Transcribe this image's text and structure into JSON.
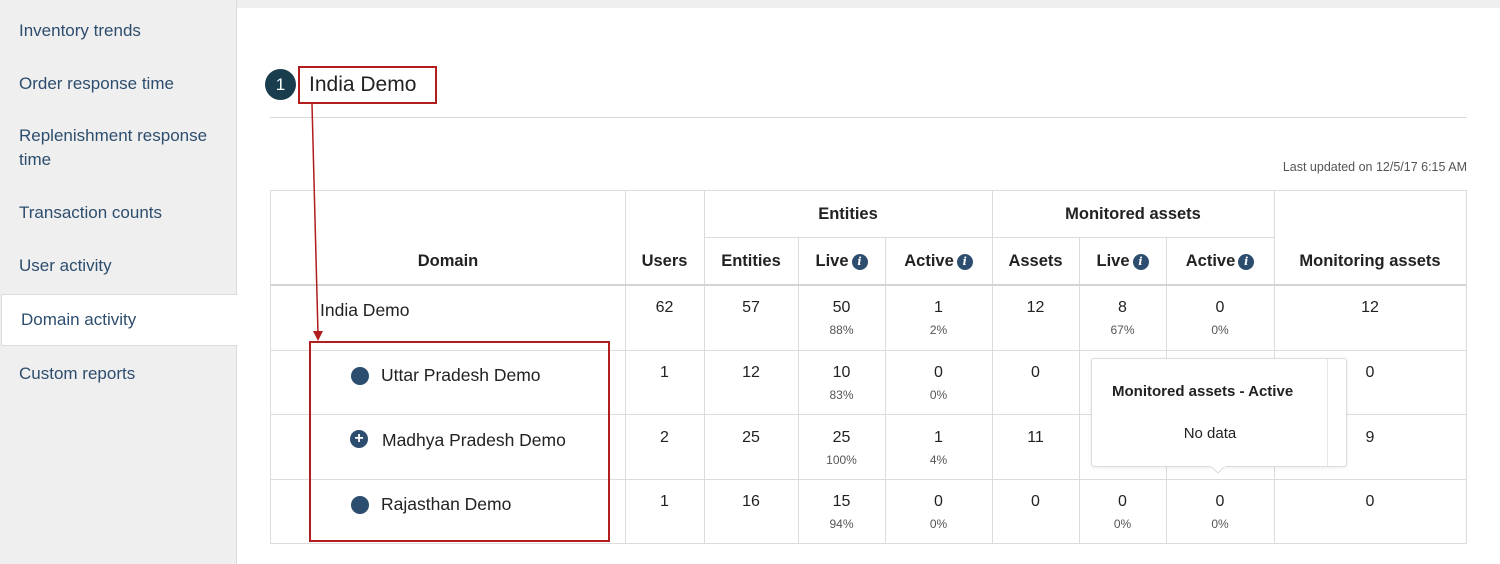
{
  "sidebar": {
    "items": [
      {
        "label": "Inventory trends"
      },
      {
        "label": "Order response time"
      },
      {
        "label": "Replenishment response time"
      },
      {
        "label": "Transaction counts"
      },
      {
        "label": "User activity"
      },
      {
        "label": "Domain activity",
        "active": true
      },
      {
        "label": "Custom reports"
      }
    ]
  },
  "header": {
    "step": "1",
    "title": "India Demo",
    "last_updated": "Last updated on 12/5/17 6:15 AM"
  },
  "table": {
    "group_headers": {
      "entities": "Entities",
      "monitored_assets": "Monitored assets"
    },
    "columns": {
      "domain": "Domain",
      "users": "Users",
      "entities": "Entities",
      "entities_live": "Live",
      "entities_active": "Active",
      "assets": "Assets",
      "assets_live": "Live",
      "assets_active": "Active",
      "monitoring_assets": "Monitoring assets"
    },
    "rows": [
      {
        "domain": "India Demo",
        "marker": "none",
        "users": "62",
        "entities": "57",
        "live": "50",
        "live_pct": "88%",
        "active": "1",
        "active_pct": "2%",
        "assets": "12",
        "assets_live": "8",
        "assets_live_pct": "67%",
        "assets_active": "0",
        "assets_active_pct": "0%",
        "monitoring": "12"
      },
      {
        "domain": "Uttar Pradesh Demo",
        "marker": "dot",
        "users": "1",
        "entities": "12",
        "live": "10",
        "live_pct": "83%",
        "active": "0",
        "active_pct": "0%",
        "assets": "0",
        "monitoring": "0"
      },
      {
        "domain": "Madhya Pradesh Demo",
        "marker": "plus",
        "users": "2",
        "entities": "25",
        "live": "25",
        "live_pct": "100%",
        "active": "1",
        "active_pct": "4%",
        "assets": "11",
        "monitoring": "9"
      },
      {
        "domain": "Rajasthan Demo",
        "marker": "dot",
        "users": "1",
        "entities": "16",
        "live": "15",
        "live_pct": "94%",
        "active": "0",
        "active_pct": "0%",
        "assets": "0",
        "assets_live": "0",
        "assets_live_pct": "0%",
        "assets_active": "0",
        "assets_active_pct": "0%",
        "monitoring": "0"
      }
    ]
  },
  "tooltip": {
    "title": "Monitored assets - Active",
    "body": "No data"
  },
  "colors": {
    "accent": "#2d4d6e",
    "annotation": "#b01e1e",
    "badge": "#1a3d4e"
  }
}
